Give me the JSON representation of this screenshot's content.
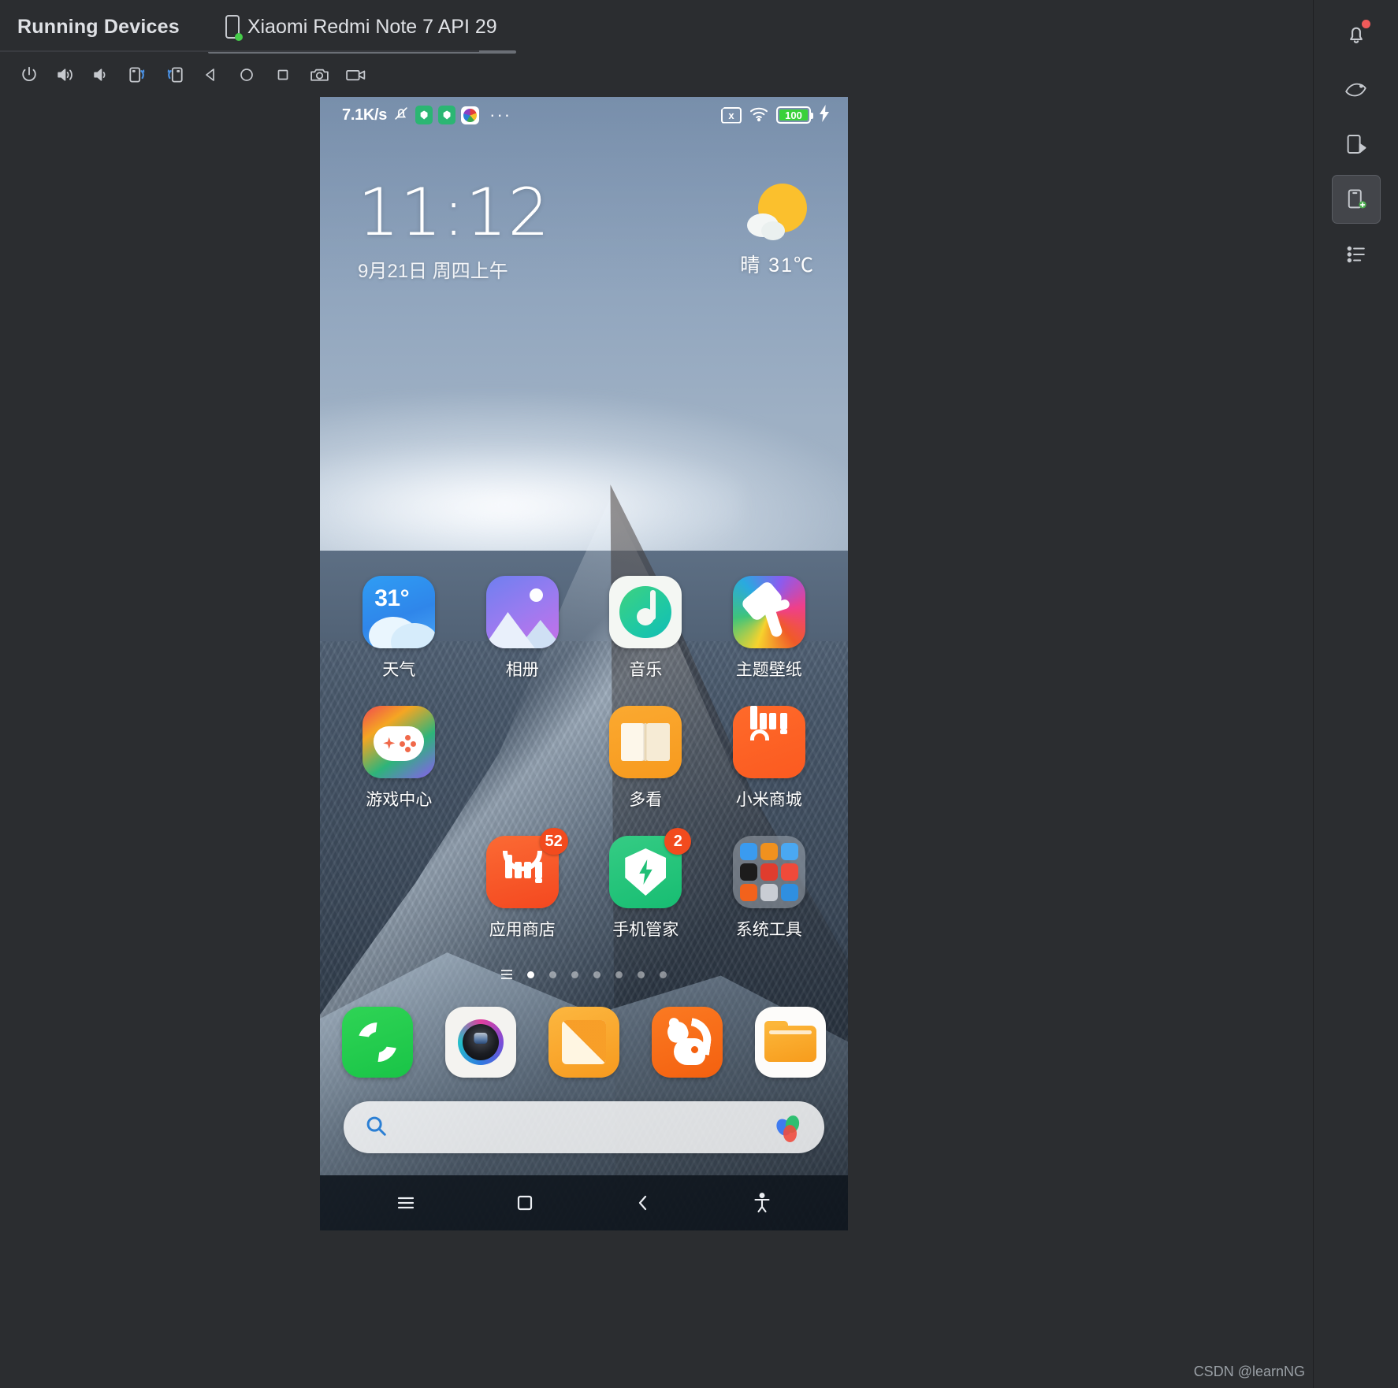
{
  "window": {
    "tool_window_title": "Running Devices",
    "device_tab_label": "Xiaomi Redmi Note 7 API 29"
  },
  "emulator_toolbar": {
    "buttons": [
      {
        "name": "power-button",
        "icon": "power-icon",
        "tooltip": "Power"
      },
      {
        "name": "volume-up-button",
        "icon": "volume-up-icon",
        "tooltip": "Volume Up"
      },
      {
        "name": "volume-down-button",
        "icon": "volume-down-icon",
        "tooltip": "Volume Down"
      },
      {
        "name": "rotate-left-button",
        "icon": "rotate-left-icon",
        "tooltip": "Rotate Left"
      },
      {
        "name": "rotate-right-button",
        "icon": "rotate-right-icon",
        "tooltip": "Rotate Right"
      },
      {
        "name": "back-button",
        "icon": "back-triangle-icon",
        "tooltip": "Back"
      },
      {
        "name": "home-button",
        "icon": "home-circle-icon",
        "tooltip": "Home"
      },
      {
        "name": "overview-button",
        "icon": "overview-square-icon",
        "tooltip": "Overview"
      },
      {
        "name": "screenshot-button",
        "icon": "camera-icon",
        "tooltip": "Take Screenshot"
      },
      {
        "name": "record-button",
        "icon": "video-camera-icon",
        "tooltip": "Record Screen"
      }
    ]
  },
  "right_strip": {
    "buttons": [
      {
        "name": "notifications-button",
        "icon": "bell-icon",
        "has_dot": true
      },
      {
        "name": "emulator-button",
        "icon": "device-mirror-icon",
        "has_dot": false
      },
      {
        "name": "layout-inspector-button",
        "icon": "layout-inspector-icon",
        "has_dot": false
      },
      {
        "name": "running-devices-button",
        "icon": "running-devices-icon",
        "has_dot": false,
        "active": true
      },
      {
        "name": "logcat-button",
        "icon": "logcat-list-icon",
        "has_dot": false
      }
    ]
  },
  "phone": {
    "status_bar": {
      "network_speed": "7.1K/s",
      "left_icons": [
        "bell-muted-icon",
        "green-shield-icon",
        "green-shield-icon",
        "rainbow-app-icon",
        "overflow-dots-icon"
      ],
      "overflow": "···",
      "sim_label": "x",
      "right_icons": [
        "no-sim-icon",
        "wifi-icon",
        "battery-icon",
        "charging-bolt-icon"
      ],
      "battery_level": "100"
    },
    "clock_widget": {
      "time": "11:12",
      "date": "9月21日 周四上午"
    },
    "weather_widget": {
      "condition": "晴",
      "temperature": "31℃",
      "combined": "晴  31℃",
      "icon": "sun-cloud-icon"
    },
    "apps": [
      {
        "label": "天气",
        "icon": "weather-icon",
        "art": "ic-weather",
        "badge": null,
        "temp": "31°"
      },
      {
        "label": "相册",
        "icon": "gallery-icon",
        "art": "ic-gallery",
        "badge": null
      },
      {
        "label": "音乐",
        "icon": "music-icon",
        "art": "ic-music",
        "badge": null
      },
      {
        "label": "主题壁纸",
        "icon": "themes-icon",
        "art": "ic-theme",
        "badge": null
      },
      {
        "label": "游戏中心",
        "icon": "game-center-icon",
        "art": "ic-game",
        "badge": null
      },
      {
        "label": "",
        "icon": "empty-slot",
        "art": "empty",
        "badge": null
      },
      {
        "label": "多看",
        "icon": "duokan-reader-icon",
        "art": "ic-book",
        "badge": null
      },
      {
        "label": "小米商城",
        "icon": "mi-store-icon",
        "art": "ic-mistore",
        "badge": null
      },
      {
        "label": "",
        "icon": "empty-slot",
        "art": "empty",
        "badge": null
      },
      {
        "label": "应用商店",
        "icon": "app-store-icon",
        "art": "ic-appstore",
        "badge": "52"
      },
      {
        "label": "手机管家",
        "icon": "security-icon",
        "art": "ic-security",
        "badge": "2"
      },
      {
        "label": "系统工具",
        "icon": "system-tools-folder-icon",
        "art": "ic-folder",
        "badge": null
      }
    ],
    "folder_tile_colors": [
      "#3a9bf0",
      "#f0911e",
      "#4aa8f2",
      "#1c1c1c",
      "#e03c2e",
      "#f04a3a",
      "#f2621c",
      "#c9cdd4",
      "#2f8fe0"
    ],
    "page_indicator": {
      "total": 7,
      "active_index": 1
    },
    "dock": [
      {
        "label": "phone",
        "icon": "phone-icon",
        "art": "ic-phone"
      },
      {
        "label": "camera",
        "icon": "camera-app-icon",
        "art": "ic-camera"
      },
      {
        "label": "notes",
        "icon": "notes-icon",
        "art": "ic-notes"
      },
      {
        "label": "browser",
        "icon": "uc-browser-icon",
        "art": "ic-browser"
      },
      {
        "label": "files",
        "icon": "file-manager-icon",
        "art": "ic-files"
      }
    ],
    "search_bar": {
      "search_icon": "search-icon",
      "assistant_icon": "assistant-icon",
      "value": ""
    },
    "nav_bar": [
      {
        "name": "nav-menu-button",
        "icon": "menu-lines-icon"
      },
      {
        "name": "nav-home-button",
        "icon": "home-square-icon"
      },
      {
        "name": "nav-back-button",
        "icon": "back-chevron-icon"
      },
      {
        "name": "nav-accessibility-button",
        "icon": "accessibility-icon"
      }
    ]
  },
  "watermark": "CSDN @learnNG",
  "colors": {
    "ide_background": "#2b2d30",
    "accent_blue": "#4a90e2",
    "badge_orange": "#f24b1e",
    "status_green": "#46cc4a",
    "battery_green": "#3ad13a"
  }
}
